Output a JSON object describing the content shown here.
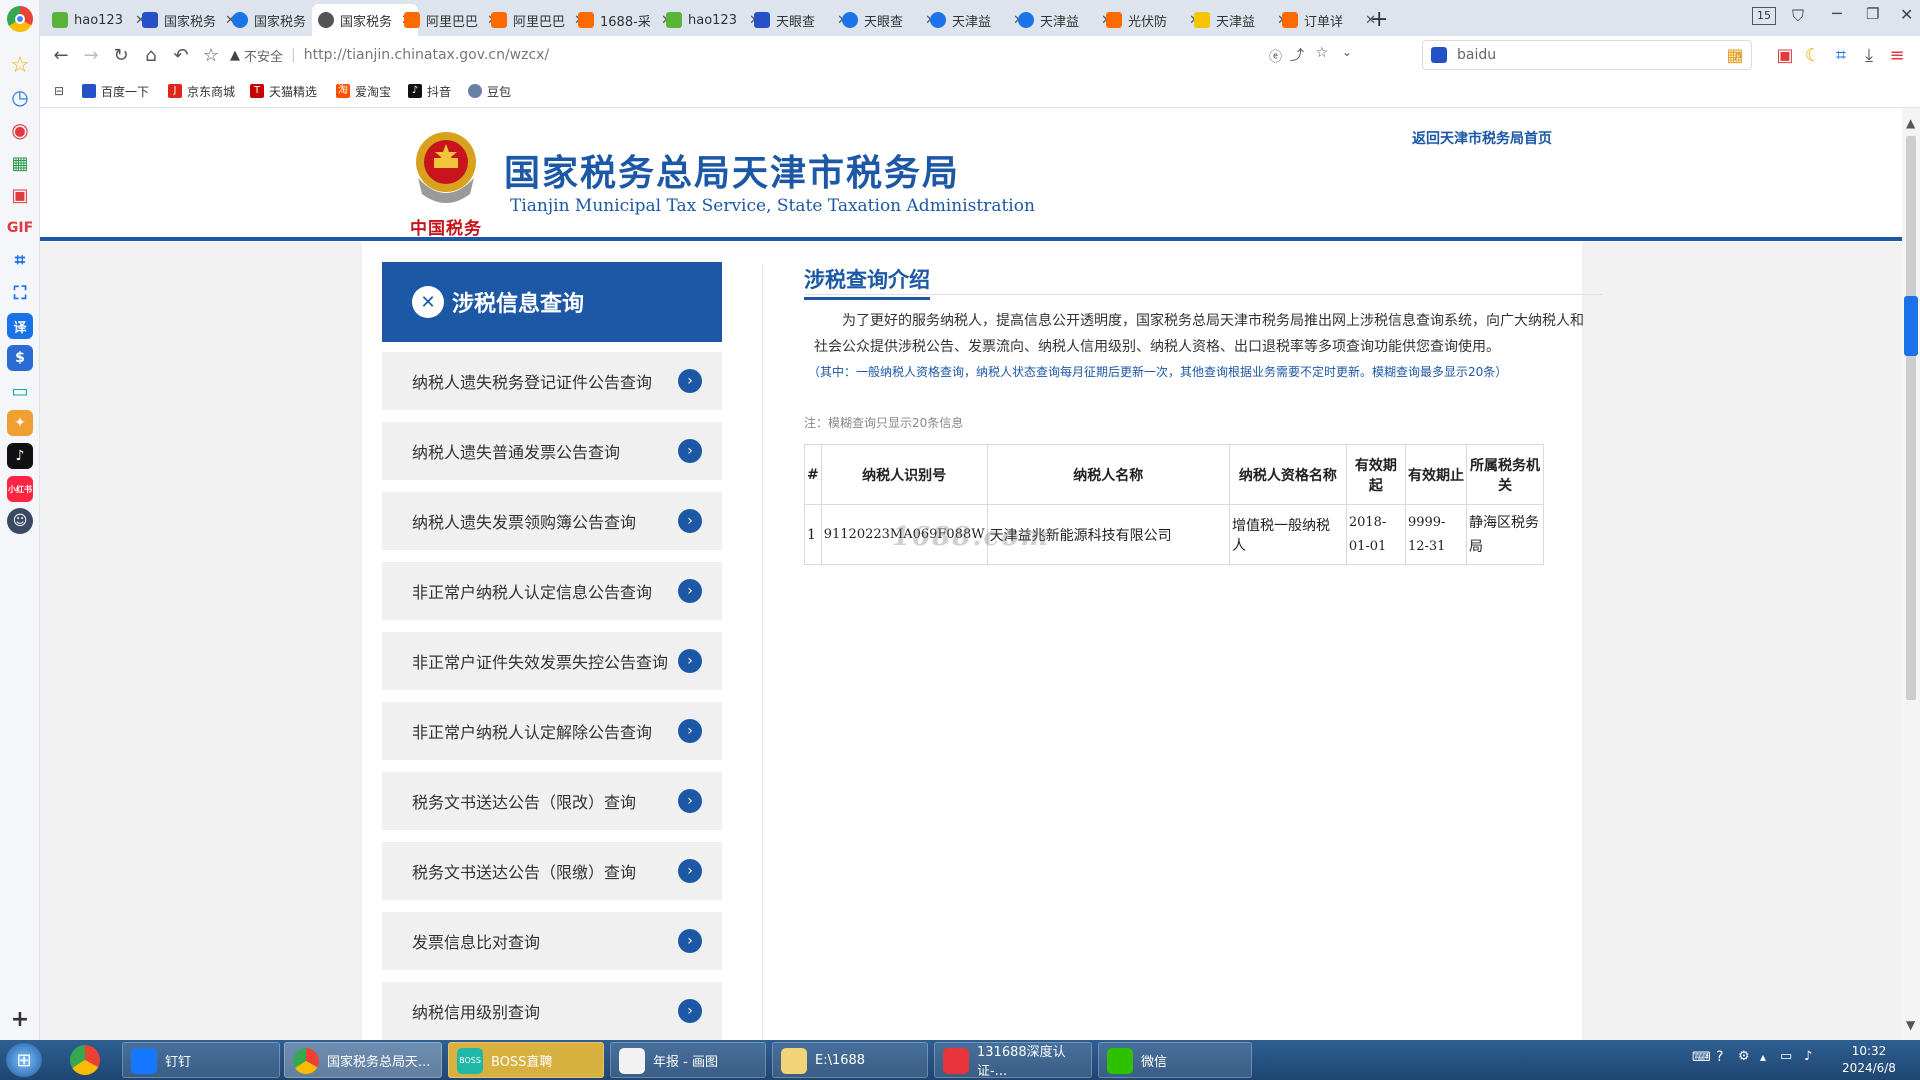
{
  "browser": {
    "tabs": [
      {
        "label": "hao123"
      },
      {
        "label": "国家税务"
      },
      {
        "label": "国家税务"
      },
      {
        "label": "国家税务"
      },
      {
        "label": "阿里巴巴"
      },
      {
        "label": "阿里巴巴"
      },
      {
        "label": "1688-采"
      },
      {
        "label": "hao123"
      },
      {
        "label": "天眼查"
      },
      {
        "label": "天眼查"
      },
      {
        "label": "天津益"
      },
      {
        "label": "天津益"
      },
      {
        "label": "光伏防"
      },
      {
        "label": "天津益"
      },
      {
        "label": "订单详"
      }
    ],
    "tab_count": "15",
    "security_label": "不安全",
    "url": "http://tianjin.chinatax.gov.cn/wzcx/",
    "search_placeholder": "baidu",
    "bookmarks": [
      "百度一下",
      "京东商城",
      "天猫精选",
      "爱淘宝",
      "抖音",
      "豆包"
    ],
    "sidebar_gif": "GIF",
    "sidebar_xhs": "小红书"
  },
  "site": {
    "title_cn": "国家税务总局天津市税务局",
    "title_en": "Tianjin Municipal Tax Service, State Taxation Administration",
    "logo_motto": "中国税务",
    "back_link": "返回天津市税务局首页"
  },
  "sidebar_menu": {
    "heading": "涉税信息查询",
    "items": [
      "纳税人遗失税务登记证件公告查询",
      "纳税人遗失普通发票公告查询",
      "纳税人遗失发票领购簿公告查询",
      "非正常户纳税人认定信息公告查询",
      "非正常户证件失效发票失控公告查询",
      "非正常户纳税人认定解除公告查询",
      "税务文书送达公告（限改）查询",
      "税务文书送达公告（限缴）查询",
      "发票信息比对查询",
      "纳税信用级别查询"
    ]
  },
  "main": {
    "section_title": "涉税查询介绍",
    "intro": "为了更好的服务纳税人，提高信息公开透明度，国家税务总局天津市税务局推出网上涉税信息查询系统，向广大纳税人和社会公众提供涉税公告、发票流向、纳税人信用级别、纳税人资格、出口退税率等多项查询功能供您查询使用。",
    "note_paren": "（其中：一般纳税人资格查询，纳税人状态查询每月征期后更新一次，其他查询根据业务需要不定时更新。模糊查询最多显示20条）",
    "tip": "注：模糊查询只显示20条信息",
    "watermark": "1688.com",
    "table": {
      "headers": [
        "#",
        "纳税人识别号",
        "纳税人名称",
        "纳税人资格名称",
        "有效期起",
        "有效期止",
        "所属税务机关"
      ],
      "rows": [
        [
          "1",
          "91120223MA069F088W",
          "天津益兆新能源科技有限公司",
          "增值税一般纳税人",
          "2018-01-01",
          "9999-12-31",
          "静海区税务局"
        ]
      ]
    }
  },
  "taskbar": {
    "items": [
      "钉钉",
      "国家税务总局天...",
      "BOSS直聘",
      "年报 - 画图",
      "E:\\1688",
      "131688深度认证-...",
      "微信"
    ],
    "boss_icon": "BOSS",
    "time": "10:32",
    "date": "2024/6/8"
  }
}
